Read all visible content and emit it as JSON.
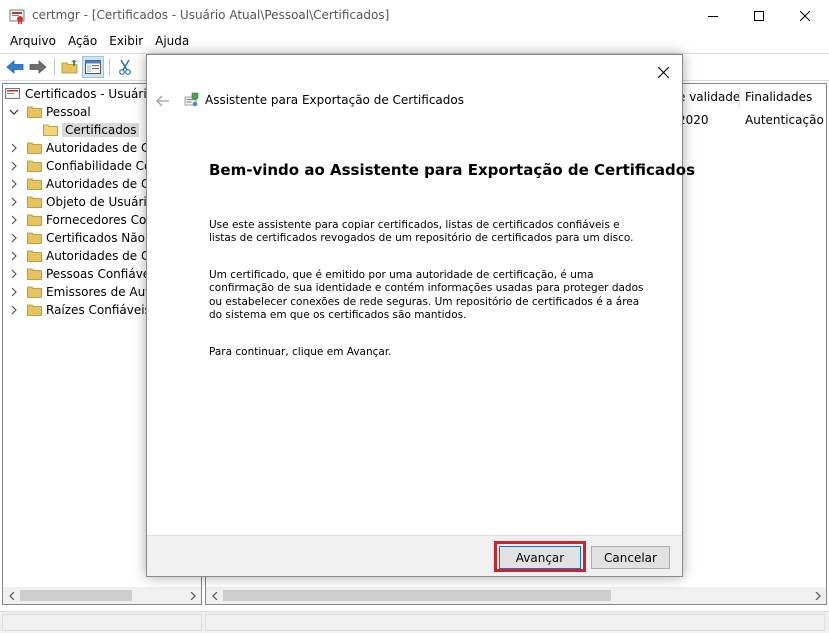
{
  "window": {
    "title": "certmgr - [Certificados - Usuário Atual\\Pessoal\\Certificados]"
  },
  "menu": [
    "Arquivo",
    "Ação",
    "Exibir",
    "Ajuda"
  ],
  "toolbar": {
    "icons": [
      "back-arrow-icon",
      "forward-arrow-icon",
      "folder-up-icon",
      "properties-view-icon",
      "scissors-cut-icon"
    ]
  },
  "tree": {
    "root": "Certificados - Usuário A",
    "pessoal": "Pessoal",
    "certificados": "Certificados",
    "items": [
      "Autoridades de Cer",
      "Confiabilidade Corp",
      "Autoridades de Cer",
      "Objeto de Usuário c",
      "Fornecedores Conf",
      "Certificados Não C",
      "Autoridades de Cer",
      "Pessoas Confiáveis",
      "Emissores de Auter",
      "Raízes Confiáveis d"
    ]
  },
  "list": {
    "columns": [
      "e validade",
      "Finalidades"
    ],
    "rows": [
      [
        "2020",
        "Autenticação d"
      ]
    ]
  },
  "dialog": {
    "title": "Assistente para Exportação de Certificados",
    "heading": "Bem-vindo ao Assistente para Exportação de Certificados",
    "para1": "Use este assistente para copiar certificados, listas de certificados confiáveis e listas de certificados revogados de um repositório de certificados para um disco.",
    "para2": "Um certificado, que é emitido por uma autoridade de certificação, é uma confirmação de sua identidade e contém informações usadas para proteger dados ou estabelecer conexões de rede seguras. Um repositório de certificados é a área do sistema em que os certificados são mantidos.",
    "para3": "Para continuar, clique em Avançar.",
    "next_label": "Avançar",
    "cancel_label": "Cancelar"
  },
  "colors": {
    "highlight": "#d0202a",
    "primary_border": "#0078d7",
    "folder": "#e8c25a"
  }
}
